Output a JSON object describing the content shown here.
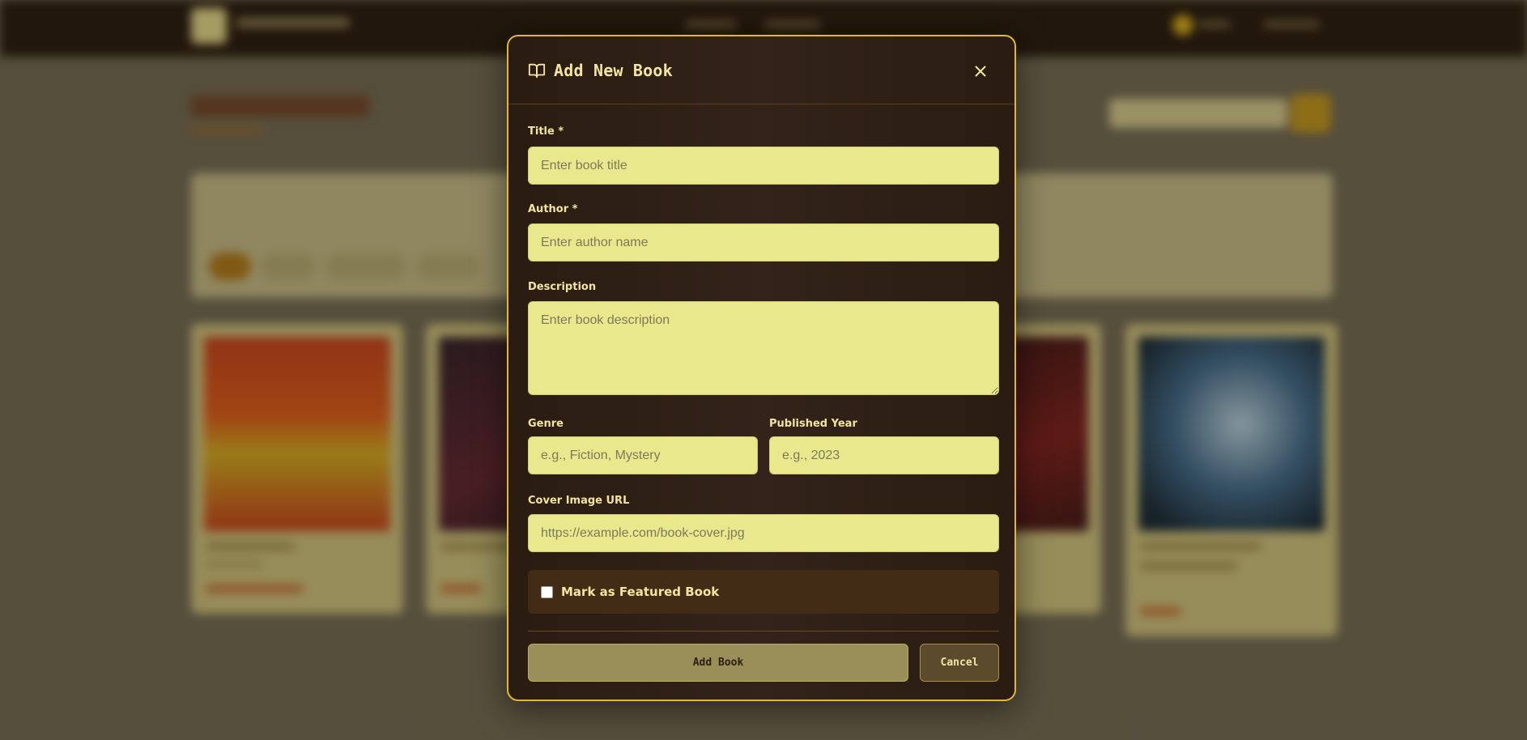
{
  "modal": {
    "title": "Add New Book",
    "title_icon": "book-open-icon",
    "close_icon": "close-icon"
  },
  "form": {
    "title": {
      "label": "Title *",
      "placeholder": "Enter book title",
      "value": ""
    },
    "author": {
      "label": "Author *",
      "placeholder": "Enter author name",
      "value": ""
    },
    "description": {
      "label": "Description",
      "placeholder": "Enter book description",
      "value": ""
    },
    "genre": {
      "label": "Genre",
      "placeholder": "e.g., Fiction, Mystery",
      "value": ""
    },
    "published_year": {
      "label": "Published Year",
      "placeholder": "e.g., 2023",
      "value": ""
    },
    "cover_url": {
      "label": "Cover Image URL",
      "placeholder": "https://example.com/book-cover.jpg",
      "value": ""
    },
    "featured": {
      "label": "Mark as Featured Book",
      "checked": false
    }
  },
  "actions": {
    "add_label": "Add Book",
    "cancel_label": "Cancel"
  },
  "colors": {
    "accent": "#e2b830",
    "input_bg": "#eae88c",
    "modal_bg": "#2a1c10",
    "text_light": "#f4e6a2"
  }
}
